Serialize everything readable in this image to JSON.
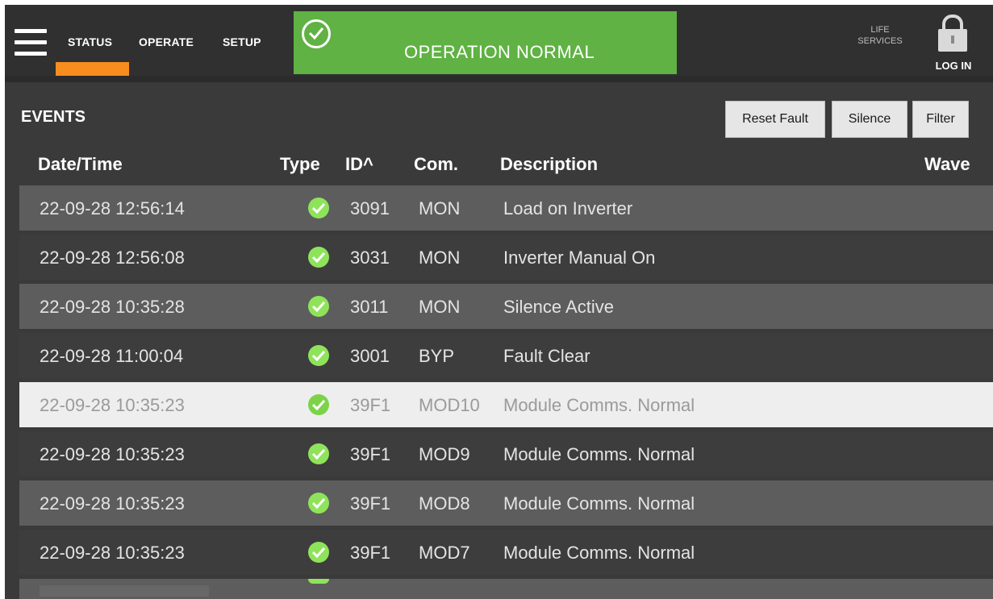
{
  "header": {
    "nav": [
      "STATUS",
      "OPERATE",
      "SETUP"
    ],
    "active_nav": "STATUS",
    "status_banner": "OPERATION NORMAL",
    "life_services_line1": "LIFE",
    "life_services_line2": "SERVICES",
    "login_label": "LOG IN",
    "accent_color": "#f78c1f",
    "status_color": "#5fb243"
  },
  "events": {
    "title": "EVENTS",
    "buttons": [
      "Reset Fault",
      "Silence",
      "Filter"
    ],
    "columns": [
      "Date/Time",
      "Type",
      "ID^",
      "Com.",
      "Description",
      "Wave"
    ],
    "rows": [
      {
        "datetime": "22-09-28 12:56:14",
        "type": "check-icon",
        "id": "3091",
        "com": "MON",
        "description": "Load on Inverter"
      },
      {
        "datetime": "22-09-28 12:56:08",
        "type": "check-icon",
        "id": "3031",
        "com": "MON",
        "description": "Inverter Manual On"
      },
      {
        "datetime": "22-09-28 10:35:28",
        "type": "check-icon",
        "id": "3011",
        "com": "MON",
        "description": "Silence Active"
      },
      {
        "datetime": "22-09-28 11:00:04",
        "type": "check-icon",
        "id": "3001",
        "com": "BYP",
        "description": "Fault Clear"
      },
      {
        "datetime": "22-09-28 10:35:23",
        "type": "check-icon",
        "id": "39F1",
        "com": "MOD10",
        "description": "Module Comms. Normal",
        "selected": true
      },
      {
        "datetime": "22-09-28 10:35:23",
        "type": "check-icon",
        "id": "39F1",
        "com": "MOD9",
        "description": "Module Comms. Normal"
      },
      {
        "datetime": "22-09-28 10:35:23",
        "type": "check-icon",
        "id": "39F1",
        "com": "MOD8",
        "description": "Module Comms. Normal"
      },
      {
        "datetime": "22-09-28 10:35:23",
        "type": "check-icon",
        "id": "39F1",
        "com": "MOD7",
        "description": "Module Comms. Normal"
      }
    ]
  }
}
